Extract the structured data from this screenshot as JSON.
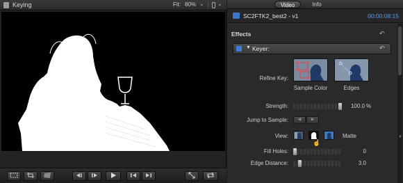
{
  "viewer": {
    "title": "Keying",
    "fit_label": "Fit:",
    "fit_value": "80%",
    "fit_chevron": "⌄",
    "switch_chevron": "⌄"
  },
  "transport": {
    "icons": [
      "viewer-overlay-icon",
      "crop-icon",
      "distort-icon",
      "previous-frame-icon",
      "next-frame-icon",
      "play-icon",
      "go-to-start-icon",
      "go-to-end-icon",
      "fullscreen-icon",
      "loop-icon"
    ]
  },
  "inspector": {
    "tabs": [
      {
        "label": "Video",
        "active": true
      },
      {
        "label": "Info",
        "active": false
      }
    ],
    "clip_name": "SC2FTK2_best2 - v1",
    "clip_timecode": "00:00:08:15",
    "effects_heading": "Effects",
    "keyer": {
      "name": "Keyer:",
      "refine_key_label": "Refine Key:",
      "sample_color_caption": "Sample Color",
      "edges_caption": "Edges",
      "strength_label": "Strength:",
      "strength_value": "100.0",
      "strength_unit": "%",
      "strength_level": 1.0,
      "jump_label": "Jump to Sample:",
      "view_label": "View:",
      "view_selected_label": "Matte",
      "fill_holes_label": "Fill Holes:",
      "fill_holes_value": "0",
      "fill_holes_level": 0.0,
      "edge_distance_label": "Edge Distance:",
      "edge_distance_value": "3.0",
      "edge_distance_level": 0.1
    }
  },
  "colors": {
    "accent_blue": "#3d7fd6",
    "timecode_blue": "#5aa0e8",
    "panel_bg": "#2b2b2b"
  }
}
